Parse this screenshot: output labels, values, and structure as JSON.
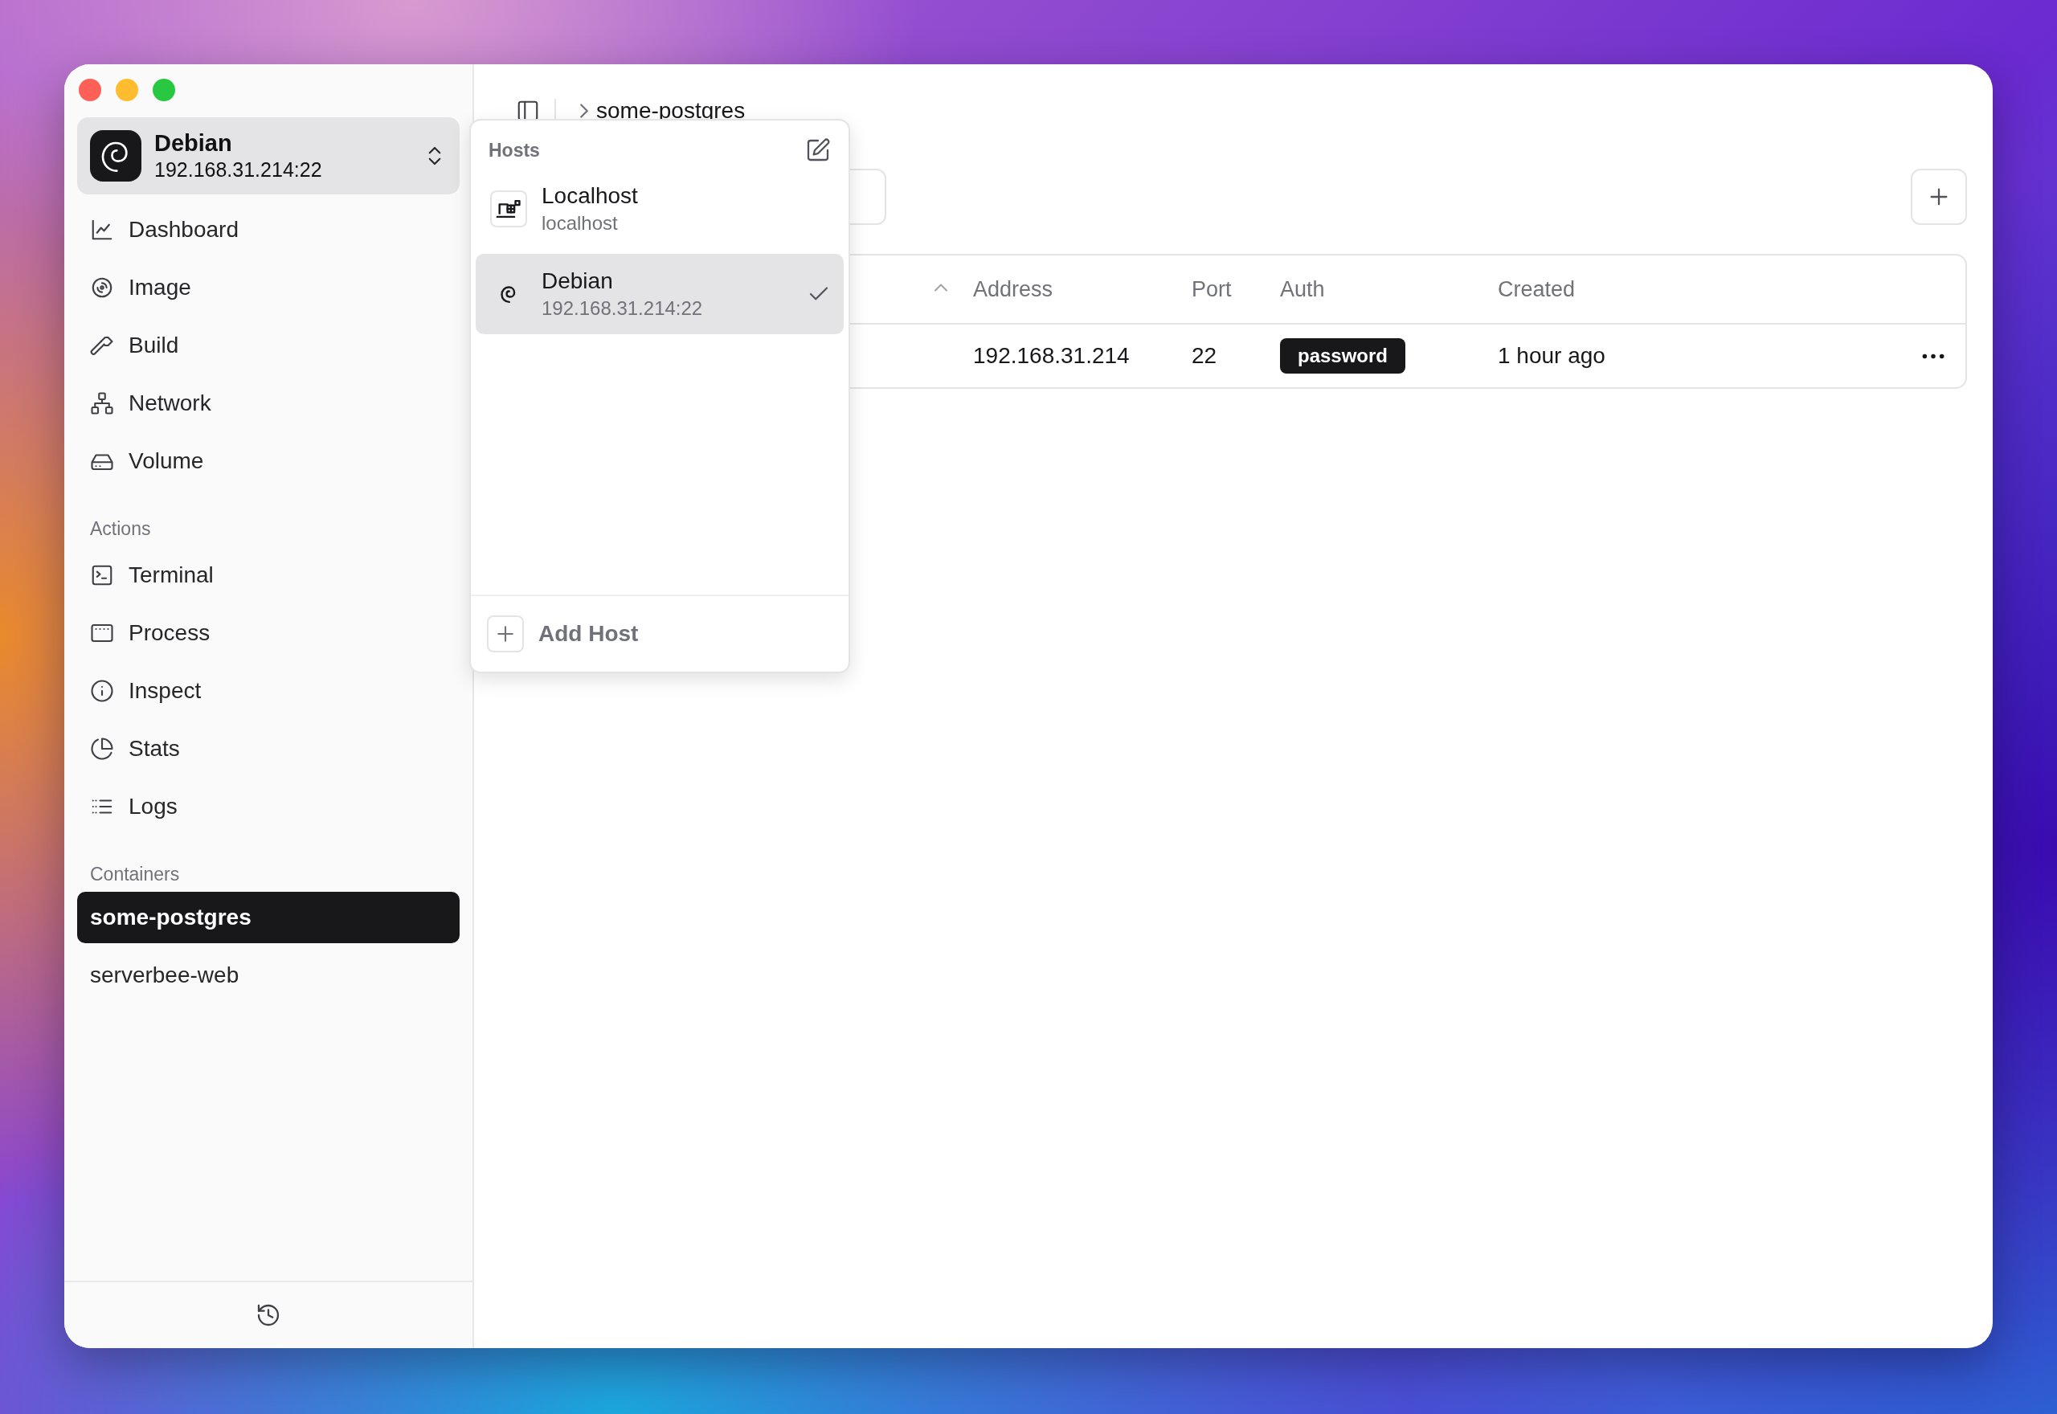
{
  "host_switcher": {
    "name": "Debian",
    "address": "192.168.31.214:22"
  },
  "nav": {
    "items": [
      {
        "label": "Dashboard"
      },
      {
        "label": "Image"
      },
      {
        "label": "Build"
      },
      {
        "label": "Network"
      },
      {
        "label": "Volume"
      }
    ]
  },
  "actions": {
    "title": "Actions",
    "items": [
      {
        "label": "Terminal"
      },
      {
        "label": "Process"
      },
      {
        "label": "Inspect"
      },
      {
        "label": "Stats"
      },
      {
        "label": "Logs"
      }
    ]
  },
  "containers": {
    "title": "Containers",
    "items": [
      {
        "label": "some-postgres",
        "selected": true
      },
      {
        "label": "serverbee-web",
        "selected": false
      }
    ]
  },
  "breadcrumb": [
    "some-postgres"
  ],
  "hosts_popup": {
    "title": "Hosts",
    "hosts": [
      {
        "name": "Localhost",
        "address": "localhost",
        "selected": false
      },
      {
        "name": "Debian",
        "address": "192.168.31.214:22",
        "selected": true
      }
    ],
    "add_label": "Add Host"
  },
  "table": {
    "columns": [
      "Address",
      "Port",
      "Auth",
      "Created"
    ],
    "rows": [
      {
        "address": "192.168.31.214",
        "port": "22",
        "auth": "password",
        "created": "1 hour ago"
      }
    ]
  }
}
